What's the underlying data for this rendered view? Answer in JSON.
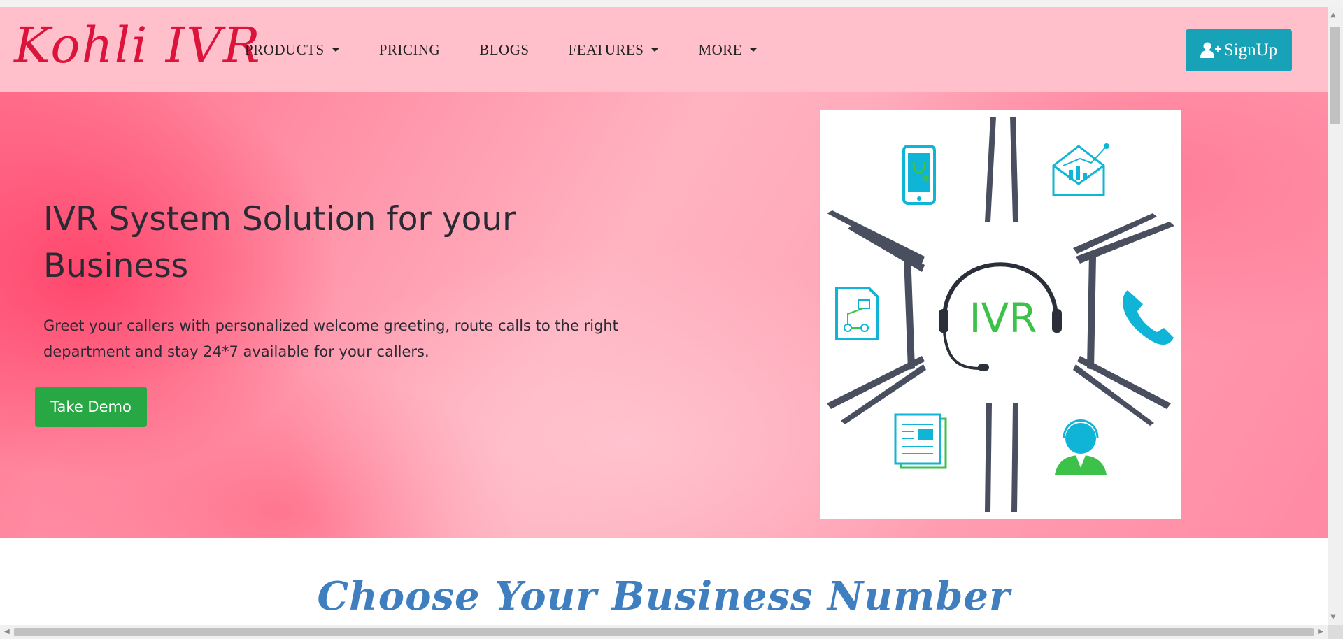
{
  "brand": {
    "name": "Kohli IVR"
  },
  "nav": {
    "items": [
      {
        "label": "PRODUCTS",
        "dropdown": true
      },
      {
        "label": "PRICING",
        "dropdown": false
      },
      {
        "label": "BLOGS",
        "dropdown": false
      },
      {
        "label": "FEATURES",
        "dropdown": true
      },
      {
        "label": "MORE",
        "dropdown": true
      }
    ],
    "signup_label": "SignUp"
  },
  "hero": {
    "title": "IVR System Solution for your Business",
    "subtitle": "Greet your callers with personalized welcome greeting, route calls to the right department and stay 24*7 available for your callers.",
    "demo_label": "Take Demo",
    "image_text": "IVR"
  },
  "section": {
    "heading": "Choose Your Business Number"
  },
  "colors": {
    "navbar": "#ffc0cb",
    "brand": "#dc143c",
    "signup": "#17a2b8",
    "demo": "#28a745",
    "heading": "#3f7fbf",
    "ivr_text": "#3cc24a",
    "icon_blue": "#10b4d6"
  },
  "icons": [
    "user-plus-icon",
    "caret-down-icon",
    "mobile-stethoscope-icon",
    "mail-chart-icon",
    "document-flow-icon",
    "phone-icon",
    "newspaper-icon",
    "support-agent-icon",
    "headset-icon"
  ]
}
